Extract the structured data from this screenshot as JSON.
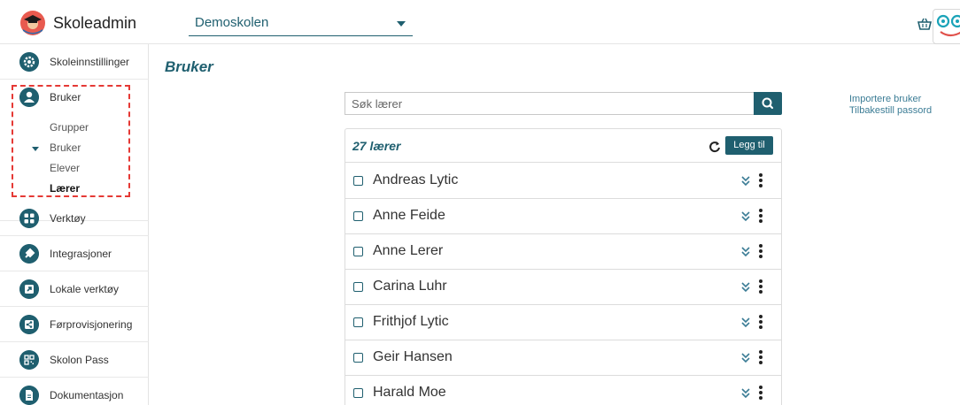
{
  "app": {
    "name": "Skoleadmin",
    "school": "Demoskolen"
  },
  "sidebar": {
    "items": [
      {
        "label": "Skoleinnstillinger",
        "icon": "gear-icon"
      },
      {
        "label": "Bruker",
        "icon": "user-icon"
      },
      {
        "label": "Verktøy",
        "icon": "grid-icon"
      },
      {
        "label": "Integrasjoner",
        "icon": "plug-icon"
      },
      {
        "label": "Lokale verktøy",
        "icon": "external-link-icon"
      },
      {
        "label": "Førprovisjonering",
        "icon": "share-icon"
      },
      {
        "label": "Skolon Pass",
        "icon": "qr-code-icon"
      },
      {
        "label": "Dokumentasjon",
        "icon": "document-icon"
      }
    ],
    "subitems": [
      {
        "label": "Grupper",
        "active": false,
        "expanded": false
      },
      {
        "label": "Bruker",
        "active": false,
        "expanded": true
      },
      {
        "label": "Elever",
        "active": false,
        "expanded": false
      },
      {
        "label": "Lærer",
        "active": true,
        "expanded": false
      }
    ]
  },
  "main": {
    "title": "Bruker",
    "search_placeholder": "Søk lærer",
    "links": [
      "Importere bruker",
      "Tilbakestill passord"
    ],
    "count_label": "27 lærer",
    "add_label": "Legg til",
    "teachers": [
      "Andreas Lytic",
      "Anne Feide",
      "Anne Lerer",
      "Carina Luhr",
      "Frithjof Lytic",
      "Geir Hansen",
      "Harald Moe"
    ]
  },
  "colors": {
    "accent": "#1f5f6f",
    "link": "#3b7c95",
    "highlight": "#e53935"
  }
}
